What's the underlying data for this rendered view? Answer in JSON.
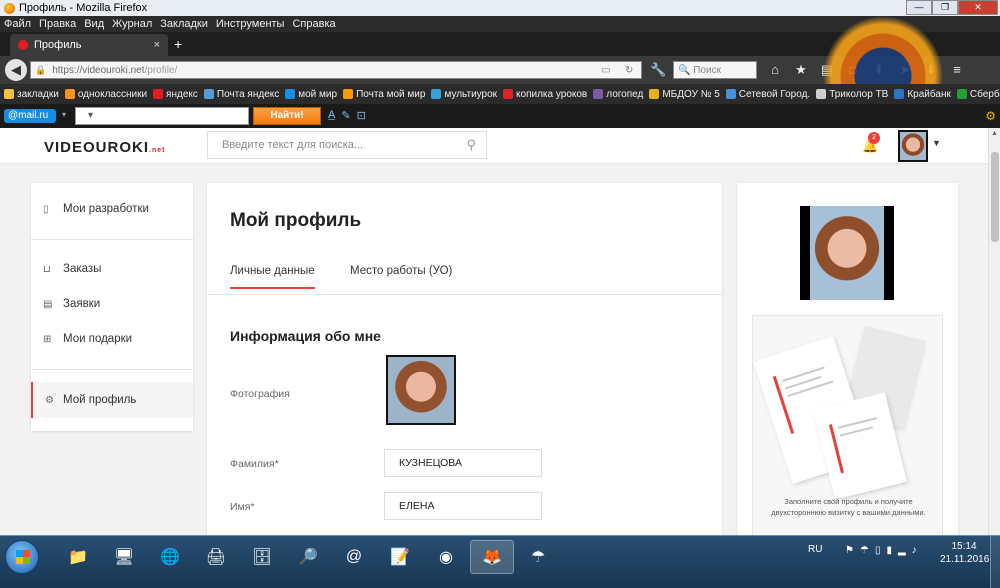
{
  "window": {
    "title": "Профиль - Mozilla Firefox"
  },
  "menu": [
    "Файл",
    "Правка",
    "Вид",
    "Журнал",
    "Закладки",
    "Инструменты",
    "Справка"
  ],
  "tab": {
    "title": "Профиль",
    "close": "×",
    "new": "+"
  },
  "nav": {
    "url_host": "https://videouroki.net",
    "url_path": "/profile/",
    "search_placeholder": "Поиск"
  },
  "bookmarks": [
    {
      "label": "закладки",
      "color": "#f0c040"
    },
    {
      "label": "одноклассники",
      "color": "#f7931e"
    },
    {
      "label": "яндекс",
      "color": "#e31b23"
    },
    {
      "label": "Почта яндекс",
      "color": "#5b9bd5"
    },
    {
      "label": "мой мир",
      "color": "#168de2"
    },
    {
      "label": "Почта мой мир",
      "color": "#f99a00"
    },
    {
      "label": "мультиурок",
      "color": "#3aa0dc"
    },
    {
      "label": "копилка уроков",
      "color": "#d9252a"
    },
    {
      "label": "логопед",
      "color": "#7b5ba8"
    },
    {
      "label": "МБДОУ № 5",
      "color": "#e6b31e"
    },
    {
      "label": "Сетевой Город.",
      "color": "#4a90d9"
    },
    {
      "label": "Триколор ТВ",
      "color": "#cfcfcf"
    },
    {
      "label": "Крайбанк",
      "color": "#2f74c0"
    },
    {
      "label": "Сбербанк",
      "color": "#21a038"
    }
  ],
  "mailbar": {
    "logo": "@mail.ru",
    "button": "Найти!"
  },
  "site": {
    "logo_main": "VIDEOUROKI",
    "logo_suffix": ".net",
    "search_placeholder": "Введите текст для поиска...",
    "notifications": "2"
  },
  "sidebar": {
    "items": [
      {
        "label": "Мои разработки",
        "icon": "document-icon"
      },
      {
        "label": "Заказы",
        "icon": "basket-icon"
      },
      {
        "label": "Заявки",
        "icon": "clipboard-icon"
      },
      {
        "label": "Мои подарки",
        "icon": "gift-icon"
      },
      {
        "label": "Мой профиль",
        "icon": "gear-icon"
      }
    ]
  },
  "profile": {
    "title": "Мой профиль",
    "tabs": [
      "Личные данные",
      "Место работы (УО)"
    ],
    "section": "Информация обо мне",
    "photo_label": "Фотография",
    "surname_label": "Фамилия*",
    "surname": "КУЗНЕЦОВА",
    "name_label": "Имя*",
    "name": "ЕЛЕНА"
  },
  "promo": {
    "text": "Заполните свой профиль и получите двухстороннюю визитку с вашими данными."
  },
  "taskbar": {
    "lang": "RU",
    "time": "15:14",
    "date": "21.11.2016"
  },
  "colors": {
    "accent": "#e8403a",
    "brand_dark": "#222222"
  }
}
